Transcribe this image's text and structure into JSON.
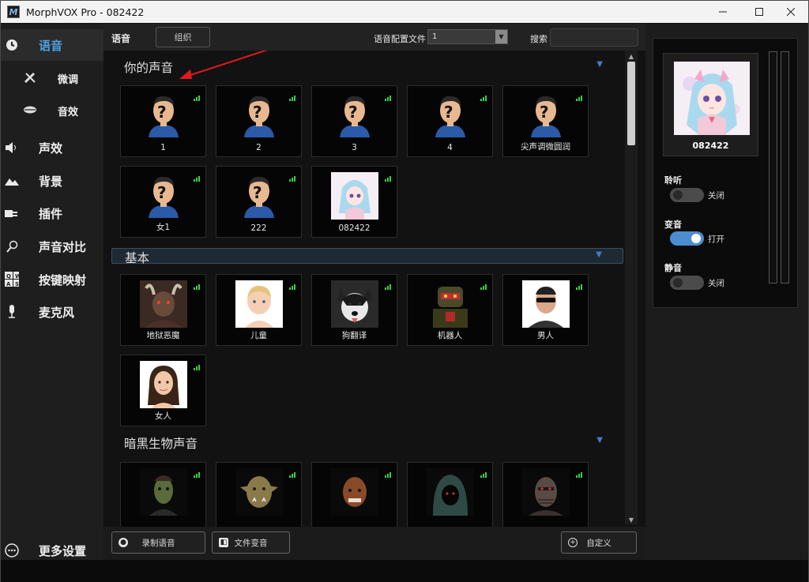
{
  "window": {
    "title": "MorphVOX Pro - 082422",
    "app_icon": "M",
    "controls": [
      "minimize-icon",
      "maximize-icon",
      "close-icon"
    ]
  },
  "nav": {
    "items": [
      {
        "key": "voice",
        "label": "语音",
        "icon": "voice-icon",
        "active": true
      },
      {
        "key": "tune",
        "label": "微调",
        "icon": "tools-icon",
        "sub": true
      },
      {
        "key": "effects",
        "label": "音效",
        "icon": "lips-icon",
        "sub": true
      },
      {
        "key": "sounds",
        "label": "声效",
        "icon": "speaker-icon"
      },
      {
        "key": "background",
        "label": "背景",
        "icon": "landscape-icon"
      },
      {
        "key": "plugins",
        "label": "插件",
        "icon": "plugin-icon"
      },
      {
        "key": "compare",
        "label": "声音对比",
        "icon": "magnifier-icon"
      },
      {
        "key": "keymap",
        "label": "按键映射",
        "icon": "keyboard-icon"
      },
      {
        "key": "mic",
        "label": "麦克风",
        "icon": "microphone-icon"
      },
      {
        "key": "more",
        "label": "更多设置",
        "icon": "more-icon"
      }
    ]
  },
  "toolbar": {
    "section_label": "语音",
    "organize_button": "组织",
    "profile_label": "语音配置文件",
    "profile_value": "1",
    "search_label": "搜索",
    "search_value": ""
  },
  "sections": [
    {
      "title": "你的声音",
      "voices": [
        {
          "name": "1",
          "face": "unknown"
        },
        {
          "name": "2",
          "face": "unknown"
        },
        {
          "name": "3",
          "face": "unknown"
        },
        {
          "name": "4",
          "face": "unknown"
        },
        {
          "name": "尖声调微圆润",
          "face": "unknown"
        },
        {
          "name": "女1",
          "face": "unknown"
        },
        {
          "name": "222",
          "face": "unknown"
        },
        {
          "name": "082422",
          "face": "anime"
        }
      ]
    },
    {
      "title": "基本",
      "voices": [
        {
          "name": "地狱恶魔",
          "face": "demon"
        },
        {
          "name": "儿童",
          "face": "child"
        },
        {
          "name": "狗翻译",
          "face": "dog"
        },
        {
          "name": "机器人",
          "face": "robot"
        },
        {
          "name": "男人",
          "face": "man"
        },
        {
          "name": "女人",
          "face": "woman"
        }
      ]
    },
    {
      "title": "暗黑生物声音",
      "voices": [
        {
          "name": "",
          "face": "zombie"
        },
        {
          "name": "",
          "face": "orc"
        },
        {
          "name": "",
          "face": "giant"
        },
        {
          "name": "",
          "face": "hood"
        },
        {
          "name": "",
          "face": "cyborg"
        }
      ]
    }
  ],
  "bottom": {
    "record_button": "录制语音",
    "file_button": "文件变音",
    "custom_button": "自定义"
  },
  "right_panel": {
    "current_voice": "082422",
    "toggles": [
      {
        "label": "聆听",
        "state": "关闭",
        "on": false
      },
      {
        "label": "变音",
        "state": "打开",
        "on": true
      },
      {
        "label": "静音",
        "state": "关闭",
        "on": false
      }
    ]
  },
  "colors": {
    "accent": "#4da3e6",
    "toggle_on": "#4a8ed0",
    "signal": "#39d24a",
    "annotation_arrow": "#e01a1a"
  }
}
